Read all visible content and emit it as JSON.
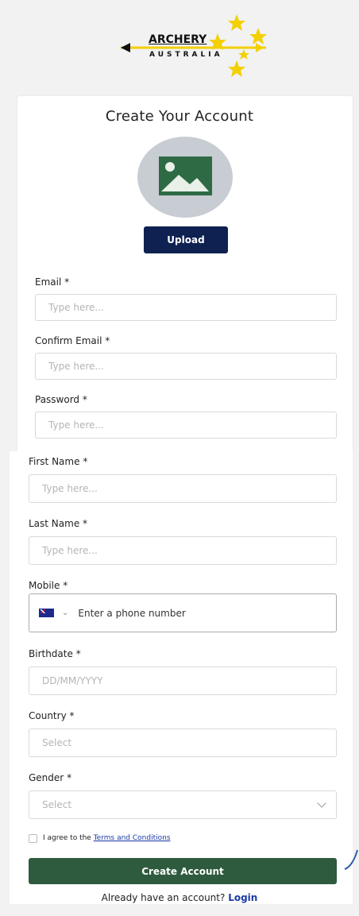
{
  "brand": {
    "logo_line1": "ARCHERY",
    "logo_line2": "AUSTRALIA",
    "colors": {
      "navy": "#0f2151",
      "green": "#2e5a3e",
      "gold": "#f3d000"
    }
  },
  "page": {
    "title": "Create Your Account",
    "upload_label": "Upload",
    "avatar_icon": "image-icon"
  },
  "form": {
    "email": {
      "label": "Email",
      "required": "*",
      "placeholder": "Type here..."
    },
    "confirm_email": {
      "label": "Confirm Email",
      "required": "*",
      "placeholder": "Type here..."
    },
    "password": {
      "label": "Password",
      "required": "*",
      "placeholder": "Type here..."
    },
    "first_name": {
      "label": "First Name",
      "required": "*",
      "placeholder": "Type here..."
    },
    "last_name": {
      "label": "Last Name",
      "required": "*",
      "placeholder": "Type here..."
    },
    "mobile": {
      "label": "Mobile",
      "required": "*",
      "placeholder": "Enter a phone number",
      "flag": "AU"
    },
    "birthdate": {
      "label": "Birthdate",
      "required": "*",
      "placeholder": "DD/MM/YYYY"
    },
    "country": {
      "label": "Country",
      "required": "*",
      "placeholder": "Select"
    },
    "gender": {
      "label": "Gender",
      "required": "*",
      "placeholder": "Select"
    }
  },
  "terms": {
    "prefix": "I agree to the ",
    "link": "Terms and Conditions"
  },
  "actions": {
    "create_label": "Create Account",
    "login_prefix": "Already have an account? ",
    "login_link": "Login"
  }
}
